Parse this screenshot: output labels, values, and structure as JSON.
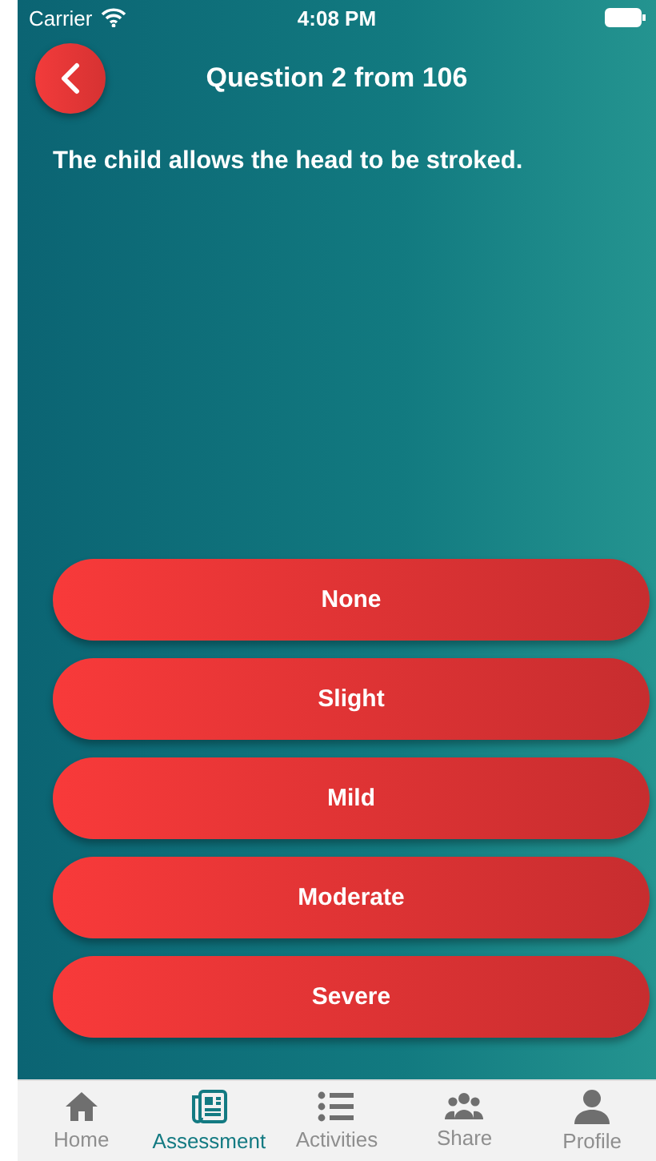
{
  "status_bar": {
    "carrier": "Carrier",
    "time": "4:08 PM"
  },
  "header": {
    "title": "Question 2 from 106"
  },
  "question": "The child allows the head to be stroked.",
  "answers": [
    "None",
    "Slight",
    "Mild",
    "Moderate",
    "Severe"
  ],
  "tabs": [
    {
      "label": "Home",
      "kind": "home",
      "selected": false
    },
    {
      "label": "Assessment",
      "kind": "news",
      "selected": true
    },
    {
      "label": "Activities",
      "kind": "list",
      "selected": false
    },
    {
      "label": "Share",
      "kind": "group",
      "selected": false
    },
    {
      "label": "Profile",
      "kind": "person",
      "selected": false
    }
  ]
}
